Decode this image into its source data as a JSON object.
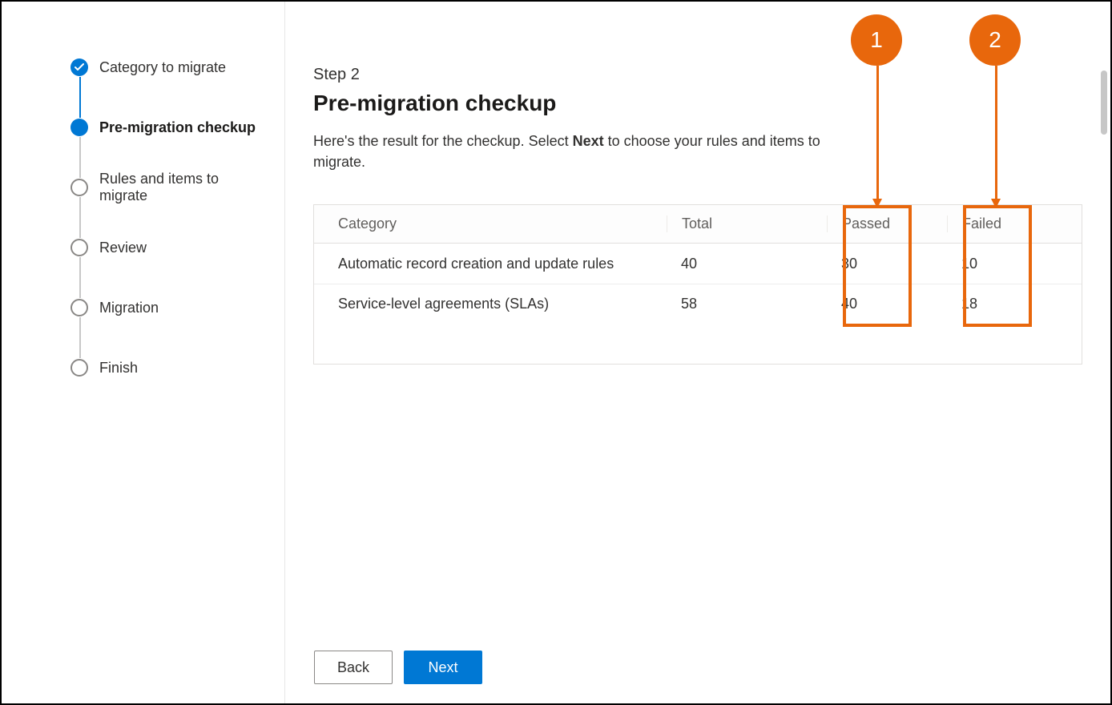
{
  "stepper": {
    "items": [
      {
        "label": "Category to migrate",
        "state": "done"
      },
      {
        "label": "Pre-migration checkup",
        "state": "current"
      },
      {
        "label": "Rules and items to migrate",
        "state": "pending"
      },
      {
        "label": "Review",
        "state": "pending"
      },
      {
        "label": "Migration",
        "state": "pending"
      },
      {
        "label": "Finish",
        "state": "pending"
      }
    ]
  },
  "main": {
    "step_label": "Step 2",
    "title": "Pre-migration checkup",
    "description_pre": "Here's the result for the checkup. Select ",
    "description_bold": "Next",
    "description_post": " to choose your rules and items to migrate."
  },
  "table": {
    "headers": {
      "category": "Category",
      "total": "Total",
      "passed": "Passed",
      "failed": "Failed"
    },
    "rows": [
      {
        "category": "Automatic record creation and update rules",
        "total": "40",
        "passed": "30",
        "failed": "10"
      },
      {
        "category": "Service-level agreements (SLAs)",
        "total": "58",
        "passed": "40",
        "failed": "18"
      }
    ]
  },
  "footer": {
    "back": "Back",
    "next": "Next"
  },
  "annotations": {
    "callouts": [
      {
        "number": "1"
      },
      {
        "number": "2"
      }
    ]
  }
}
